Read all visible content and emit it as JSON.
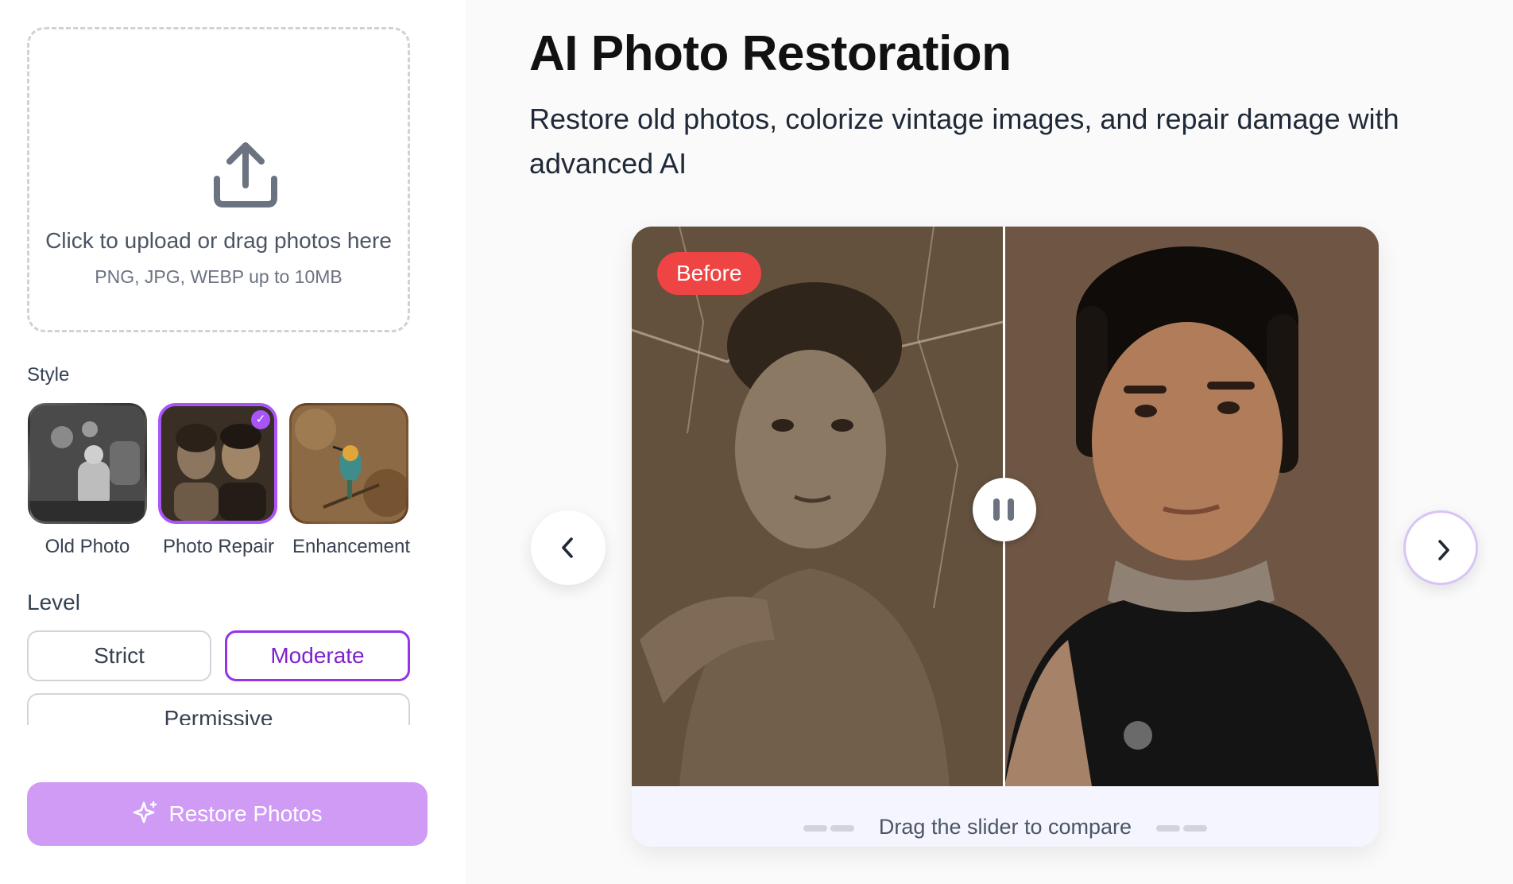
{
  "upload": {
    "title": "Click to upload or drag photos here",
    "subtitle": "PNG, JPG, WEBP up to 10MB",
    "icon": "upload-icon"
  },
  "style": {
    "label": "Style",
    "options": [
      {
        "label": "Old Photo",
        "selected": false
      },
      {
        "label": "Photo Repair",
        "selected": true
      },
      {
        "label": "Enhancement",
        "selected": false
      }
    ]
  },
  "level": {
    "label": "Level",
    "options": [
      {
        "label": "Strict",
        "selected": false
      },
      {
        "label": "Moderate",
        "selected": true
      },
      {
        "label": "Permissive",
        "selected": false
      }
    ]
  },
  "restore_button": {
    "label": "Restore Photos",
    "icon": "sparkle-icon"
  },
  "header": {
    "title": "AI Photo Restoration",
    "subtitle": "Restore old photos, colorize vintage images, and repair damage with advanced AI"
  },
  "compare": {
    "before_badge": "Before",
    "hint": "Drag the slider to compare"
  },
  "colors": {
    "accent": "#a855f7",
    "accent_dark": "#7e22ce",
    "restore_button_bg": "#cf9bf5",
    "before_badge_bg": "#ef4444",
    "panel_bg": "#fafafb"
  }
}
